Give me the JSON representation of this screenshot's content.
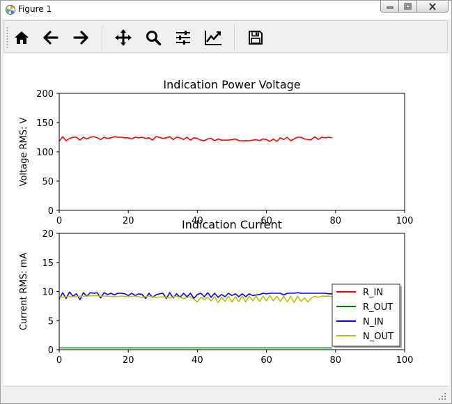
{
  "window": {
    "title": "Figure 1",
    "icons": [
      "matplotlib-logo-icon",
      "minimize-icon",
      "maximize-icon",
      "close-icon"
    ]
  },
  "toolbar": {
    "buttons": [
      {
        "name": "home-icon",
        "tooltip": "Home"
      },
      {
        "name": "back-arrow-icon",
        "tooltip": "Back"
      },
      {
        "name": "forward-arrow-icon",
        "tooltip": "Forward"
      },
      {
        "name": "pan-icon",
        "tooltip": "Pan"
      },
      {
        "name": "zoom-icon",
        "tooltip": "Zoom"
      },
      {
        "name": "subplots-icon",
        "tooltip": "Subplots"
      },
      {
        "name": "customize-icon",
        "tooltip": "Customize"
      },
      {
        "name": "save-icon",
        "tooltip": "Save"
      }
    ]
  },
  "chart_data": [
    {
      "type": "line",
      "title": "Indication Power Voltage",
      "xlabel": "",
      "ylabel": "Voltage RMS: V",
      "xlim": [
        0,
        100
      ],
      "ylim": [
        0,
        200
      ],
      "xticks": [
        "0",
        "20",
        "40",
        "60",
        "80",
        "100"
      ],
      "yticks": [
        "0",
        "50",
        "100",
        "150",
        "200"
      ],
      "grid": false,
      "series": [
        {
          "color": "#ff0000",
          "x": [
            0,
            1,
            2,
            3,
            4,
            5,
            6,
            7,
            8,
            9,
            10,
            11,
            12,
            13,
            14,
            15,
            16,
            17,
            18,
            19,
            20,
            21,
            22,
            23,
            24,
            25,
            26,
            27,
            28,
            29,
            30,
            31,
            32,
            33,
            34,
            35,
            36,
            37,
            38,
            39,
            40,
            41,
            42,
            43,
            44,
            45,
            46,
            47,
            48,
            49,
            50,
            51,
            52,
            53,
            54,
            55,
            56,
            57,
            58,
            59,
            60,
            61,
            62,
            63,
            64,
            65,
            66,
            67,
            68,
            69,
            70,
            71,
            72,
            73,
            74,
            75,
            76,
            77,
            78,
            79
          ],
          "values": [
            118,
            126,
            119,
            123,
            125,
            125,
            120,
            125,
            122,
            125,
            126,
            124,
            121,
            125,
            123,
            124,
            126,
            125,
            125,
            124,
            124,
            122,
            125,
            124,
            125,
            123,
            124,
            120,
            126,
            125,
            123,
            124,
            126,
            121,
            125,
            124,
            121,
            125,
            120,
            124,
            123,
            120,
            119,
            122,
            123,
            119,
            122,
            120,
            120,
            120,
            121,
            122,
            119,
            119,
            119,
            119,
            120,
            121,
            119,
            122,
            121,
            118,
            122,
            118,
            124,
            121,
            125,
            119,
            122,
            125,
            125,
            122,
            121,
            121,
            126,
            121,
            125,
            124,
            125,
            124
          ]
        }
      ]
    },
    {
      "type": "line",
      "title": "Indication Current",
      "xlabel": "",
      "ylabel": "Current RMS: mA",
      "xlim": [
        0,
        100
      ],
      "ylim": [
        0,
        20
      ],
      "xticks": [
        "0",
        "20",
        "40",
        "60",
        "80",
        "100"
      ],
      "yticks": [
        "0",
        "5",
        "10",
        "15",
        "20"
      ],
      "grid": false,
      "legend_position": "lower-right",
      "series": [
        {
          "name": "R_IN",
          "color": "#ff0000",
          "x": [],
          "values": []
        },
        {
          "name": "R_OUT",
          "color": "#008000",
          "x": [
            0,
            10,
            20,
            30,
            40,
            50,
            60,
            70,
            79
          ],
          "values": [
            0.3,
            0.3,
            0.3,
            0.3,
            0.3,
            0.3,
            0.3,
            0.3,
            0.3
          ]
        },
        {
          "name": "N_IN",
          "color": "#0000ff",
          "x": [
            0,
            1,
            2,
            3,
            4,
            5,
            6,
            7,
            8,
            9,
            10,
            11,
            12,
            13,
            14,
            15,
            16,
            17,
            18,
            19,
            20,
            21,
            22,
            23,
            24,
            25,
            26,
            27,
            28,
            29,
            30,
            31,
            32,
            33,
            34,
            35,
            36,
            37,
            38,
            39,
            40,
            41,
            42,
            43,
            44,
            45,
            46,
            47,
            48,
            49,
            50,
            51,
            52,
            53,
            54,
            55,
            56,
            57,
            58,
            59,
            60,
            61,
            62,
            63,
            64,
            65,
            66,
            67,
            68,
            69,
            70,
            71,
            72,
            73,
            74,
            75,
            76,
            77,
            78,
            79
          ],
          "values": [
            8.7,
            9.8,
            8.8,
            9.9,
            9.2,
            9.6,
            8.6,
            9.8,
            9.2,
            9.8,
            9.7,
            9.8,
            8.9,
            9.8,
            9.5,
            9.7,
            9.4,
            9.7,
            9.7,
            9.6,
            9.3,
            9.7,
            9.3,
            9.6,
            9.5,
            8.8,
            9.7,
            9.0,
            9.4,
            9.6,
            9.7,
            8.8,
            9.8,
            8.9,
            9.6,
            9.0,
            9.7,
            9.1,
            9.7,
            8.8,
            9.5,
            9.7,
            9.1,
            9.8,
            9.0,
            9.7,
            9.0,
            9.5,
            9.1,
            9.7,
            9.3,
            9.6,
            9.1,
            9.6,
            9.1,
            9.6,
            9.3,
            9.4,
            9.5,
            9.7,
            9.6,
            9.7,
            9.7,
            9.7,
            9.7,
            9.4,
            9.7,
            9.7,
            9.7,
            9.8,
            9.7,
            9.7,
            9.7,
            9.7,
            9.7,
            9.7,
            9.7,
            9.7,
            9.6,
            9.6
          ]
        },
        {
          "name": "N_OUT",
          "color": "#bfbf00",
          "x": [
            0,
            2,
            4,
            6,
            8,
            10,
            12,
            14,
            16,
            18,
            20,
            22,
            24,
            26,
            28,
            30,
            32,
            34,
            36,
            38,
            40,
            41,
            42,
            43,
            44,
            45,
            46,
            47,
            48,
            49,
            50,
            51,
            52,
            53,
            54,
            55,
            56,
            57,
            58,
            59,
            60,
            61,
            62,
            63,
            64,
            65,
            66,
            67,
            68,
            69,
            70,
            71,
            72,
            73,
            74,
            75,
            76,
            77,
            78,
            79
          ],
          "values": [
            9.0,
            9.1,
            9.1,
            9.2,
            9.2,
            9.3,
            9.2,
            9.2,
            9.1,
            9.2,
            9.1,
            9.2,
            9.0,
            9.2,
            9.0,
            9.1,
            8.9,
            9.2,
            8.8,
            9.1,
            8.2,
            9.0,
            8.6,
            9.0,
            8.4,
            9.1,
            8.1,
            9.0,
            8.3,
            9.2,
            8.2,
            9.1,
            8.3,
            9.2,
            8.2,
            9.2,
            8.4,
            9.2,
            8.3,
            9.2,
            8.4,
            9.3,
            8.4,
            9.2,
            8.3,
            9.2,
            8.2,
            9.2,
            8.1,
            9.2,
            8.3,
            8.9,
            8.2,
            8.9,
            9.2,
            9.0,
            9.2,
            9.2,
            9.2,
            9.1
          ]
        }
      ]
    }
  ]
}
